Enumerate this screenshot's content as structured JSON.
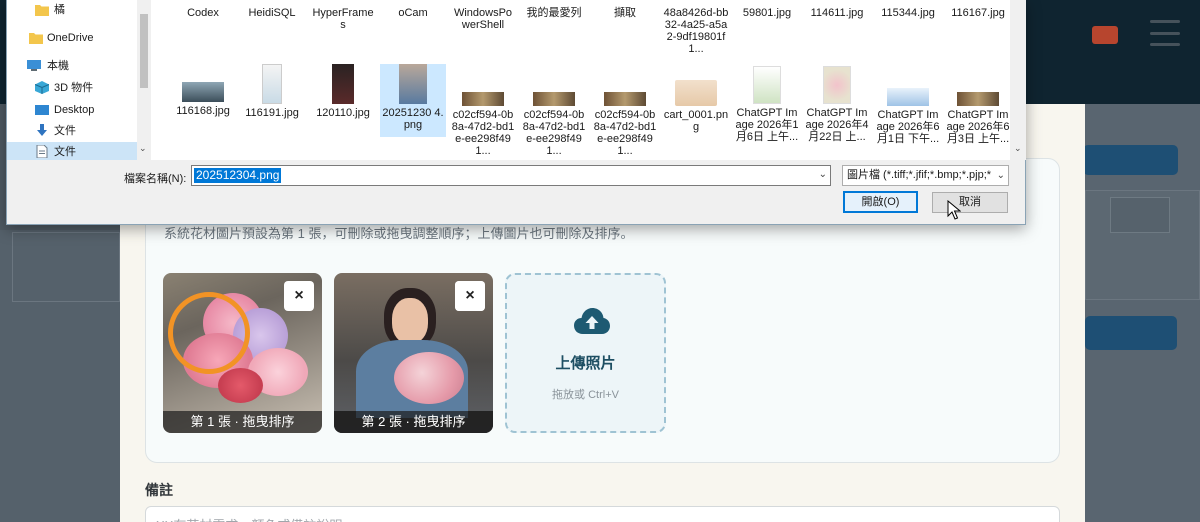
{
  "dialog": {
    "nav_items": [
      {
        "label": "橘",
        "icon": "folder-icon"
      },
      {
        "label": "OneDrive",
        "icon": "folder-icon"
      },
      {
        "label": "本機",
        "icon": "computer-icon"
      },
      {
        "label": "3D 物件",
        "icon": "cube-icon"
      },
      {
        "label": "Desktop",
        "icon": "desktop-icon"
      },
      {
        "label": "文件",
        "icon": "download-arrow-icon"
      },
      {
        "label": "文件",
        "icon": "document-icon"
      }
    ],
    "files_row1": [
      {
        "label": "Codex"
      },
      {
        "label": "HeidiSQL"
      },
      {
        "label": "HyperFrames"
      },
      {
        "label": "oCam"
      },
      {
        "label": "WindowsPowerShell"
      },
      {
        "label": "我的最愛列"
      },
      {
        "label": "擷取"
      },
      {
        "label": "48a8426d-bb32-4a25-a5a2-9df19801f1..."
      },
      {
        "label": "59801.jpg"
      },
      {
        "label": "114611.jpg"
      },
      {
        "label": "115344.jpg"
      },
      {
        "label": "116167.jpg"
      }
    ],
    "files_row2": [
      {
        "label": "116168.jpg"
      },
      {
        "label": "116191.jpg"
      },
      {
        "label": "120110.jpg"
      },
      {
        "label": "20251230 4.png"
      },
      {
        "label": "c02cf594-0b8a-47d2-bd1e-ee298f491..."
      },
      {
        "label": "c02cf594-0b8a-47d2-bd1e-ee298f491..."
      },
      {
        "label": "c02cf594-0b8a-47d2-bd1e-ee298f491..."
      },
      {
        "label": "cart_0001.png"
      },
      {
        "label": "ChatGPT Image 2026年1月6日 上午..."
      },
      {
        "label": "ChatGPT Image 2026年4月22日 上..."
      },
      {
        "label": "ChatGPT Image 2026年6月1日 下午..."
      },
      {
        "label": "ChatGPT Image 2026年6月3日 上午..."
      }
    ],
    "filename_label": "檔案名稱(N):",
    "filename_value": "202512304.png",
    "filter_value": "圖片檔 (*.tiff;*.jfif;*.bmp;*.pjp;*",
    "open_label": "開啟(O)",
    "cancel_label": "取消"
  },
  "page": {
    "hint_text": "系統花材圖片預設為第 1 張，可刪除或拖曳調整順序；上傳圖片也可刪除及排序。",
    "photos": [
      {
        "caption": "第 1 張 · 拖曳排序",
        "close": "×"
      },
      {
        "caption": "第 2 張 · 拖曳排序",
        "close": "×"
      }
    ],
    "upload_title": "上傳照片",
    "upload_sub": "拖放或 Ctrl+V",
    "notes_label": "備註",
    "notes_placeholder": "XX有花材需求、顏色或備註說明"
  },
  "colors": {
    "accent": "#0078d7",
    "marker": "#f29325",
    "upload_icon": "#1e5a72"
  }
}
